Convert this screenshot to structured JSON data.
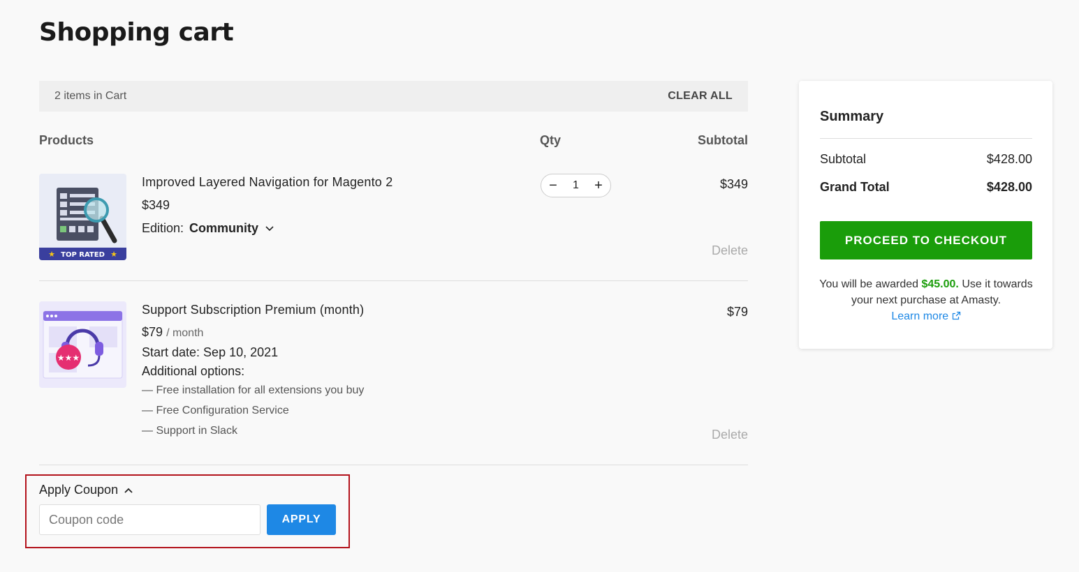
{
  "page_title": "Shopping cart",
  "cart_bar": {
    "count_text": "2 items in Cart",
    "clear_all": "CLEAR ALL"
  },
  "columns": {
    "products": "Products",
    "qty": "Qty",
    "subtotal": "Subtotal"
  },
  "items": [
    {
      "name": "Improved Layered Navigation for Magento 2",
      "price": "$349",
      "edition_label": "Edition:",
      "edition_value": "Community",
      "badge": "TOP RATED",
      "qty": "1",
      "subtotal": "$349",
      "delete": "Delete"
    },
    {
      "name": "Support Subscription Premium (month)",
      "price": "$79",
      "unit": "/ month",
      "start_date": "Start date: Sep 10, 2021",
      "options_label": "Additional options:",
      "options": [
        "— Free installation for all extensions you buy",
        "— Free Configuration Service",
        "— Support in Slack"
      ],
      "subtotal": "$79",
      "delete": "Delete"
    }
  ],
  "coupon": {
    "toggle_label": "Apply Coupon",
    "placeholder": "Coupon code",
    "apply_label": "APPLY"
  },
  "summary": {
    "title": "Summary",
    "subtotal_label": "Subtotal",
    "subtotal_value": "$428.00",
    "grand_total_label": "Grand Total",
    "grand_total_value": "$428.00",
    "checkout_label": "PROCEED TO CHECKOUT",
    "reward_prefix": "You will be awarded",
    "reward_amount": "$45.00.",
    "reward_suffix": "Use it towards your next purchase at Amasty.",
    "learn_more": "Learn more"
  },
  "colors": {
    "checkout_green": "#1a9d0a",
    "apply_blue": "#1e88e5",
    "highlight_red": "#b3121b"
  }
}
